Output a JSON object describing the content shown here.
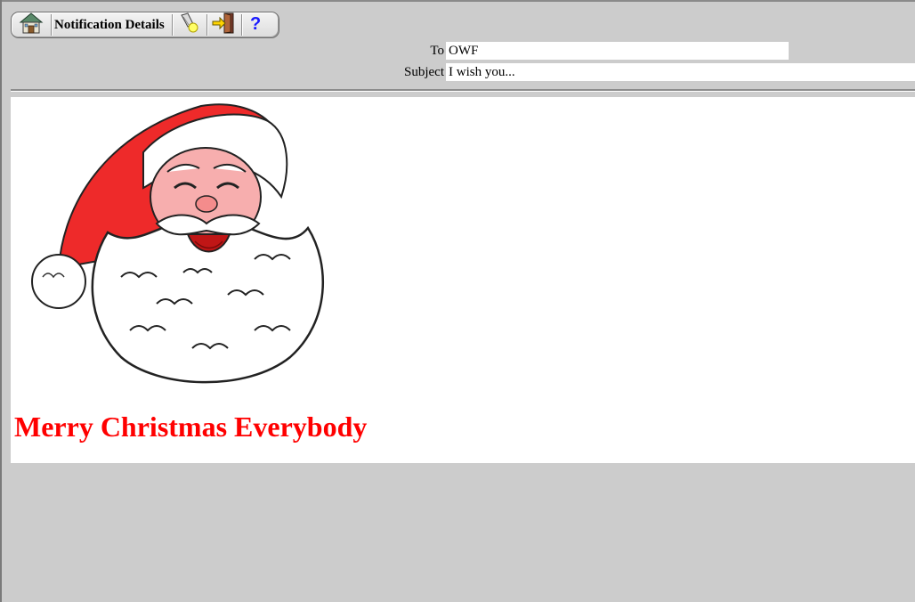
{
  "toolbar": {
    "title": "Notification Details",
    "buttons": [
      {
        "icon": "home-icon"
      },
      {
        "icon": "flashlight-icon"
      },
      {
        "icon": "exit-door-icon"
      },
      {
        "icon": "help-question-icon"
      }
    ]
  },
  "header": {
    "to_label": "To",
    "to_value": "OWF",
    "subject_label": "Subject",
    "subject_value": "I wish you..."
  },
  "message": {
    "greeting": "Merry Christmas Everybody",
    "greeting_color": "#ff0000",
    "image": "santa-claus-illustration"
  },
  "colors": {
    "background": "#cccccc",
    "content_background": "#ffffff",
    "help_icon": "#1a1aff"
  }
}
